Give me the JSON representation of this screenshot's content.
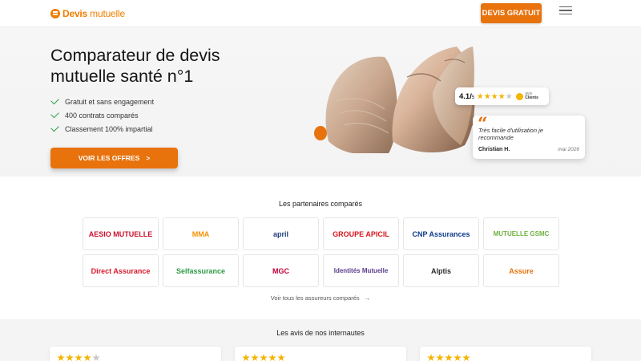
{
  "header": {
    "logo_bold": "Devis",
    "logo_light": "mutuelle",
    "cta_label": "DEVIS GRATUIT",
    "menu_icon": "hamburger-icon"
  },
  "hero": {
    "title": "Comparateur de devis mutuelle santé n°1",
    "checks": [
      {
        "label": "Gratuit et sans engagement"
      },
      {
        "label": "400 contrats comparés"
      },
      {
        "label": "Classement 100% impartial"
      }
    ],
    "cta_label": "VOIR LES OFFRES",
    "cta_arrow": ">",
    "rating": {
      "value": "4.1/",
      "scale": "5",
      "stars_filled": 4,
      "stars_total": 5,
      "badge_top": "avis",
      "badge_bottom": "Clients"
    },
    "review": {
      "text": "Très facile d'utilisation je recommande",
      "author": "Christian H.",
      "date": "mai 2026"
    }
  },
  "partners": {
    "title": "Les partenaires comparés",
    "logos": [
      {
        "name": "AESIO MUTUELLE",
        "color": "#c8102e"
      },
      {
        "name": "MMA",
        "color": "#f39200"
      },
      {
        "name": "april",
        "color": "#1d3c78"
      },
      {
        "name": "GROUPE APICIL",
        "color": "#d9141c"
      },
      {
        "name": "CNP Assurances",
        "color": "#0d3a8b"
      },
      {
        "name": "MUTUELLE GSMC",
        "color": "#6fb13f"
      },
      {
        "name": "Direct Assurance",
        "color": "#d8172a"
      },
      {
        "name": "Selfassurance",
        "color": "#2e9b45"
      },
      {
        "name": "MGC",
        "color": "#c0003c"
      },
      {
        "name": "Identités Mutuelle",
        "color": "#5a3d8e"
      },
      {
        "name": "Alptis",
        "color": "#2b2b2b"
      },
      {
        "name": "Assure",
        "color": "#e8720c"
      }
    ],
    "all_link": "Voir tous les assureurs comparés",
    "all_arrow": "→"
  },
  "reviews": {
    "title": "Les avis de nos internautes",
    "cards": [
      {
        "stars_filled": 4
      },
      {
        "stars_filled": 5
      },
      {
        "stars_filled": 5
      }
    ]
  },
  "colors": {
    "accent": "#e8720c",
    "check": "#2e9b45",
    "star": "#f4b400"
  }
}
